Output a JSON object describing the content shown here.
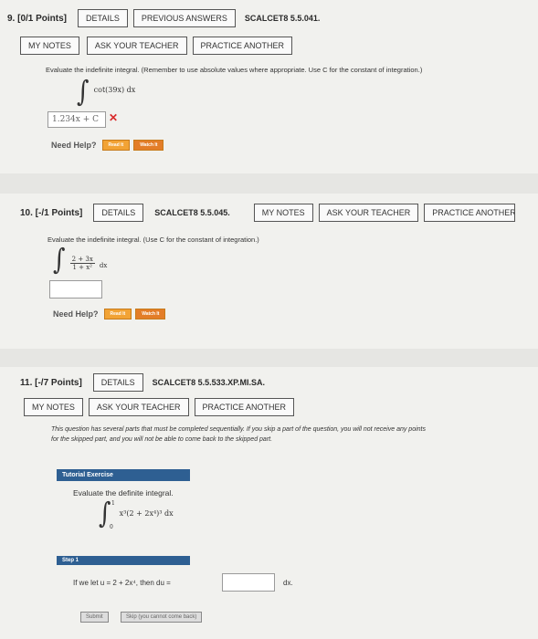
{
  "q9": {
    "number": "9. [0/1 Points]",
    "details": "DETAILS",
    "previous_answers": "PREVIOUS ANSWERS",
    "code": "SCALCET8 5.5.041.",
    "my_notes": "MY NOTES",
    "ask_teacher": "ASK YOUR TEACHER",
    "practice": "PRACTICE ANOTHER",
    "instruction": "Evaluate the indefinite integral. (Remember to use absolute values where appropriate. Use C for the constant of integration.)",
    "integrand": "cot(39x) dx",
    "answer": "1.234x + C",
    "help_label": "Need Help?",
    "read": "Read It",
    "watch": "Watch It"
  },
  "q10": {
    "number": "10. [-/1 Points]",
    "details": "DETAILS",
    "code": "SCALCET8 5.5.045.",
    "my_notes": "MY NOTES",
    "ask_teacher": "ASK YOUR TEACHER",
    "practice": "PRACTICE ANOTHER",
    "instruction": "Evaluate the indefinite integral. (Use C for the constant of integration.)",
    "numerator": "2 + 3x",
    "denominator": "1 + x²",
    "dx": "dx",
    "answer": "",
    "help_label": "Need Help?",
    "read": "Read It",
    "watch": "Watch It"
  },
  "q11": {
    "number": "11. [-/7 Points]",
    "details": "DETAILS",
    "code": "SCALCET8 5.5.533.XP.MI.SA.",
    "my_notes": "MY NOTES",
    "ask_teacher": "ASK YOUR TEACHER",
    "practice": "PRACTICE ANOTHER",
    "notice_line1": "This question has several parts that must be completed sequentially. If you skip a part of the question, you will not receive any points",
    "notice_line2": "for the skipped part, and you will not be able to come back to the skipped part.",
    "tutorial_label": "Tutorial Exercise",
    "evaluate": "Evaluate the definite integral.",
    "upper": "1",
    "lower": "0",
    "integrand": "x³(2 + 2x⁴)³ dx",
    "step_label": "Step 1",
    "step_text": "If we let u = 2 + 2x⁴, then du =",
    "dx_after": "dx.",
    "submit": "Submit",
    "skip": "Skip (you cannot come back)"
  }
}
